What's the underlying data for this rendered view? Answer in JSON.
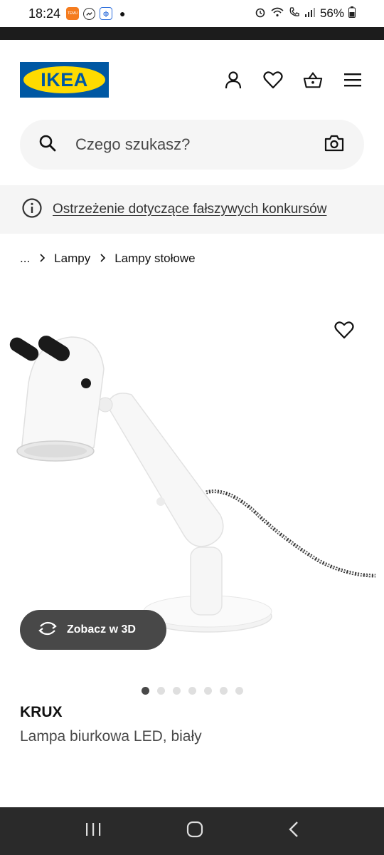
{
  "status": {
    "time": "18:24",
    "notif_temu": "TEMU",
    "notif_app": "ф",
    "battery": "56%",
    "icons": [
      "temu-icon",
      "messenger-icon",
      "app-icon",
      "alarm-icon",
      "wifi-icon",
      "call-icon",
      "signal-icon",
      "battery-icon"
    ]
  },
  "header": {
    "logo": "IKEA",
    "icons": [
      "user-icon",
      "heart-icon",
      "basket-icon",
      "menu-icon"
    ]
  },
  "search": {
    "placeholder": "Czego szukasz?",
    "icons": [
      "search-icon",
      "camera-icon"
    ]
  },
  "warning": {
    "text": "Ostrzeżenie dotyczące fałszywych konkursów",
    "icon": "info-icon"
  },
  "breadcrumb": {
    "items": [
      "...",
      "Lampy",
      "Lampy stołowe"
    ]
  },
  "gallery": {
    "view3d_label": "Zobacz w 3D",
    "total_images": 7,
    "active_index": 0
  },
  "product": {
    "name": "KRUX",
    "description": "Lampa biurkowa LED, biały"
  },
  "colors": {
    "ikea_blue": "#0058a3",
    "ikea_yellow": "#ffdb00",
    "pill_bg": "#484848"
  }
}
